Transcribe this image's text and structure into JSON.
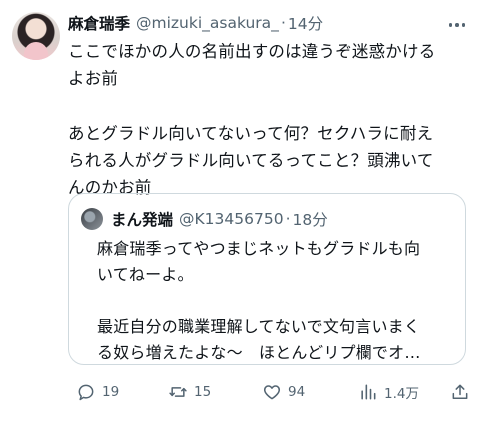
{
  "tweet": {
    "author_name": "麻倉瑞季",
    "author_handle": "@mizuki_asakura_",
    "separator": "·",
    "time": "14分",
    "text_lines": [
      "ここでほかの人の名前出すのは違うぞ迷惑かける",
      "よお前",
      "",
      "あとグラドル向いてないって何？セクハラに耐え",
      "られる人がグラドル向いてるってこと？頭沸いて",
      "んのかお前"
    ]
  },
  "quoted": {
    "author_name": "まん発端",
    "author_handle": "@K13456750",
    "separator": "·",
    "time": "18分",
    "text_lines": [
      "麻倉瑞季ってやつまじネットもグラドルも向",
      "いてねーよ。",
      "",
      "最近自分の職業理解してないで文句言いまく",
      "る奴ら増えたよな〜　ほとんどリプ欄でオ…"
    ]
  },
  "actions": {
    "reply_count": "19",
    "retweet_count": "15",
    "like_count": "94",
    "views_count": "1.4万",
    "share_count": ""
  },
  "icons": {
    "more": "more-horizontal-icon",
    "reply": "reply-bubble-icon",
    "retweet": "retweet-icon",
    "like": "heart-icon",
    "views": "views-bar-chart-icon",
    "share": "share-upload-icon"
  },
  "colors": {
    "text": "#0f1419",
    "secondary": "#536471",
    "border": "#cfd9de",
    "background": "#ffffff"
  }
}
